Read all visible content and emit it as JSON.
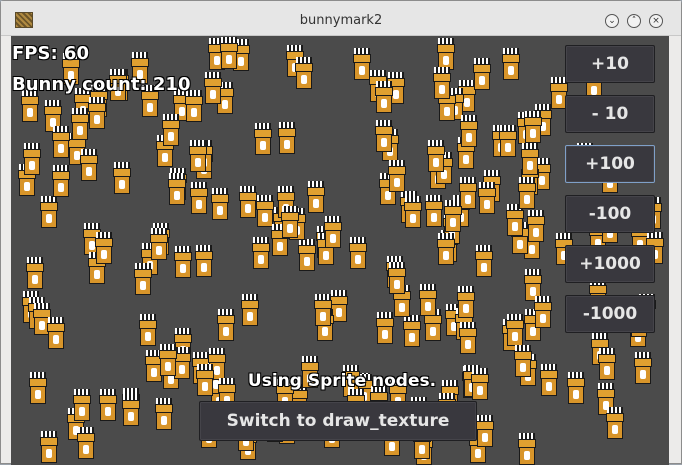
{
  "window": {
    "title": "bunnymark2",
    "minimize_label": "⌄",
    "maximize_label": "˄",
    "close_label": "×"
  },
  "hud": {
    "fps": "FPS: 60",
    "bunny_count": "Bunny count: 210"
  },
  "buttons": [
    {
      "label": "+10"
    },
    {
      "label": "- 10"
    },
    {
      "label": "+100"
    },
    {
      "label": "-100"
    },
    {
      "label": "+1000"
    },
    {
      "label": "-1000"
    }
  ],
  "mode": {
    "label": "Using Sprite nodes.",
    "switch_button": "Switch to draw_texture"
  },
  "icons": [
    "app-icon",
    "minimize-icon",
    "maximize-icon",
    "close-icon",
    "bunny-sprite"
  ],
  "colors": {
    "canvas_bg": "#4b4b4b",
    "button_bg": "#39383e",
    "bunny_body": "#d8952a",
    "titlebar": "#e6e6e6"
  }
}
